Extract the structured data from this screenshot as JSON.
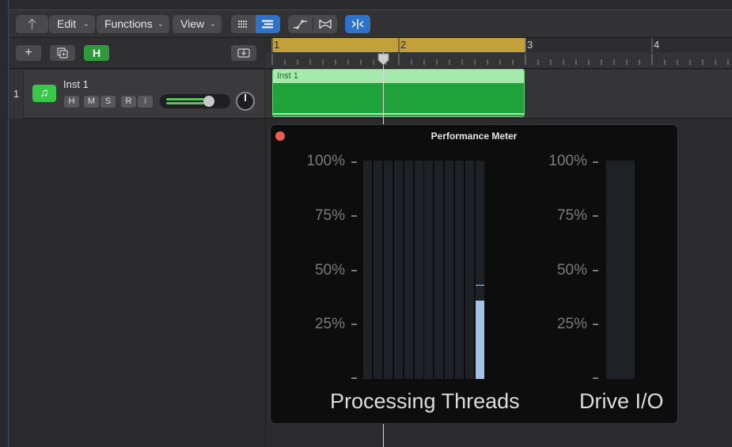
{
  "toolbar": {
    "back_icon": "back-arrow-icon",
    "menus": [
      {
        "label": "Edit"
      },
      {
        "label": "Functions"
      },
      {
        "label": "View"
      }
    ],
    "view_icons": [
      "grid-view-icon",
      "list-view-icon"
    ],
    "tool_icons": [
      "automation-curve-icon",
      "flex-icon"
    ],
    "catch_icon": "catch-playhead-icon",
    "accent_color": "#2f72c9"
  },
  "track_header": {
    "add_button": "+",
    "duplicate_icon": "duplicate-track-icon",
    "global_h_label": "H",
    "download_icon": "download-tray-icon"
  },
  "track": {
    "number": "1",
    "name": "Inst 1",
    "icon": "music-note-icon",
    "buttons": [
      "H",
      "M",
      "S",
      "R",
      "I"
    ],
    "volume_level": 0.54,
    "track_color": "#39c74a"
  },
  "ruler": {
    "bars": [
      "1",
      "2",
      "3",
      "4"
    ],
    "cycle_color": "#c3a13a"
  },
  "region": {
    "name": "Inst 1",
    "color": "#1fa33a"
  },
  "performance_meter": {
    "title": "Performance Meter",
    "y_ticks": [
      "100%",
      "75%",
      "50%",
      "25%"
    ],
    "processing_label": "Processing Threads",
    "drive_label": "Drive I/O",
    "thread_values": [
      0,
      0,
      0,
      0,
      0,
      0,
      0,
      0,
      0,
      0,
      0,
      0.36
    ],
    "thread_peaks": [
      0,
      0,
      0,
      0,
      0,
      0,
      0,
      0,
      0,
      0,
      0,
      0.43
    ],
    "drive_value": 0,
    "fill_color": "#a3c4ea"
  }
}
